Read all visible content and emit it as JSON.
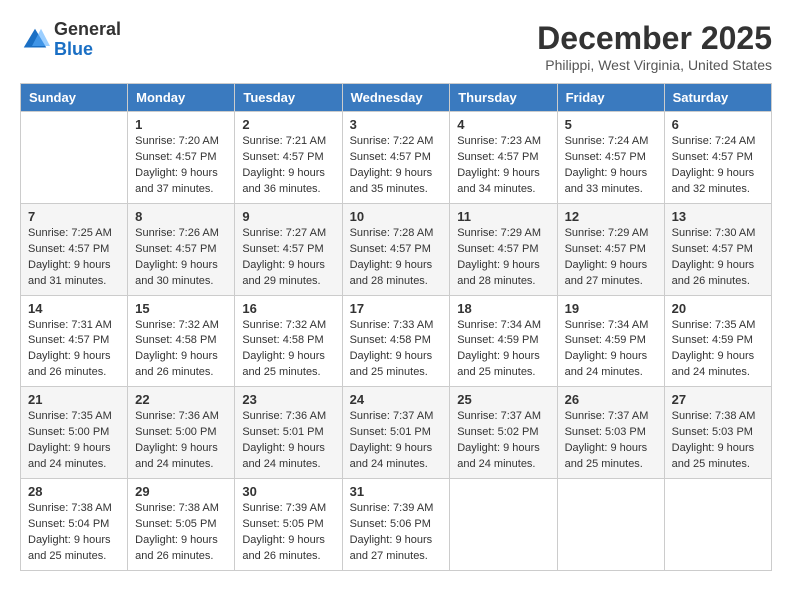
{
  "header": {
    "logo_general": "General",
    "logo_blue": "Blue",
    "month_title": "December 2025",
    "location": "Philippi, West Virginia, United States"
  },
  "calendar": {
    "days_of_week": [
      "Sunday",
      "Monday",
      "Tuesday",
      "Wednesday",
      "Thursday",
      "Friday",
      "Saturday"
    ],
    "weeks": [
      [
        {
          "day": "",
          "info": ""
        },
        {
          "day": "1",
          "info": "Sunrise: 7:20 AM\nSunset: 4:57 PM\nDaylight: 9 hours\nand 37 minutes."
        },
        {
          "day": "2",
          "info": "Sunrise: 7:21 AM\nSunset: 4:57 PM\nDaylight: 9 hours\nand 36 minutes."
        },
        {
          "day": "3",
          "info": "Sunrise: 7:22 AM\nSunset: 4:57 PM\nDaylight: 9 hours\nand 35 minutes."
        },
        {
          "day": "4",
          "info": "Sunrise: 7:23 AM\nSunset: 4:57 PM\nDaylight: 9 hours\nand 34 minutes."
        },
        {
          "day": "5",
          "info": "Sunrise: 7:24 AM\nSunset: 4:57 PM\nDaylight: 9 hours\nand 33 minutes."
        },
        {
          "day": "6",
          "info": "Sunrise: 7:24 AM\nSunset: 4:57 PM\nDaylight: 9 hours\nand 32 minutes."
        }
      ],
      [
        {
          "day": "7",
          "info": "Sunrise: 7:25 AM\nSunset: 4:57 PM\nDaylight: 9 hours\nand 31 minutes."
        },
        {
          "day": "8",
          "info": "Sunrise: 7:26 AM\nSunset: 4:57 PM\nDaylight: 9 hours\nand 30 minutes."
        },
        {
          "day": "9",
          "info": "Sunrise: 7:27 AM\nSunset: 4:57 PM\nDaylight: 9 hours\nand 29 minutes."
        },
        {
          "day": "10",
          "info": "Sunrise: 7:28 AM\nSunset: 4:57 PM\nDaylight: 9 hours\nand 28 minutes."
        },
        {
          "day": "11",
          "info": "Sunrise: 7:29 AM\nSunset: 4:57 PM\nDaylight: 9 hours\nand 28 minutes."
        },
        {
          "day": "12",
          "info": "Sunrise: 7:29 AM\nSunset: 4:57 PM\nDaylight: 9 hours\nand 27 minutes."
        },
        {
          "day": "13",
          "info": "Sunrise: 7:30 AM\nSunset: 4:57 PM\nDaylight: 9 hours\nand 26 minutes."
        }
      ],
      [
        {
          "day": "14",
          "info": "Sunrise: 7:31 AM\nSunset: 4:57 PM\nDaylight: 9 hours\nand 26 minutes."
        },
        {
          "day": "15",
          "info": "Sunrise: 7:32 AM\nSunset: 4:58 PM\nDaylight: 9 hours\nand 26 minutes."
        },
        {
          "day": "16",
          "info": "Sunrise: 7:32 AM\nSunset: 4:58 PM\nDaylight: 9 hours\nand 25 minutes."
        },
        {
          "day": "17",
          "info": "Sunrise: 7:33 AM\nSunset: 4:58 PM\nDaylight: 9 hours\nand 25 minutes."
        },
        {
          "day": "18",
          "info": "Sunrise: 7:34 AM\nSunset: 4:59 PM\nDaylight: 9 hours\nand 25 minutes."
        },
        {
          "day": "19",
          "info": "Sunrise: 7:34 AM\nSunset: 4:59 PM\nDaylight: 9 hours\nand 24 minutes."
        },
        {
          "day": "20",
          "info": "Sunrise: 7:35 AM\nSunset: 4:59 PM\nDaylight: 9 hours\nand 24 minutes."
        }
      ],
      [
        {
          "day": "21",
          "info": "Sunrise: 7:35 AM\nSunset: 5:00 PM\nDaylight: 9 hours\nand 24 minutes."
        },
        {
          "day": "22",
          "info": "Sunrise: 7:36 AM\nSunset: 5:00 PM\nDaylight: 9 hours\nand 24 minutes."
        },
        {
          "day": "23",
          "info": "Sunrise: 7:36 AM\nSunset: 5:01 PM\nDaylight: 9 hours\nand 24 minutes."
        },
        {
          "day": "24",
          "info": "Sunrise: 7:37 AM\nSunset: 5:01 PM\nDaylight: 9 hours\nand 24 minutes."
        },
        {
          "day": "25",
          "info": "Sunrise: 7:37 AM\nSunset: 5:02 PM\nDaylight: 9 hours\nand 24 minutes."
        },
        {
          "day": "26",
          "info": "Sunrise: 7:37 AM\nSunset: 5:03 PM\nDaylight: 9 hours\nand 25 minutes."
        },
        {
          "day": "27",
          "info": "Sunrise: 7:38 AM\nSunset: 5:03 PM\nDaylight: 9 hours\nand 25 minutes."
        }
      ],
      [
        {
          "day": "28",
          "info": "Sunrise: 7:38 AM\nSunset: 5:04 PM\nDaylight: 9 hours\nand 25 minutes."
        },
        {
          "day": "29",
          "info": "Sunrise: 7:38 AM\nSunset: 5:05 PM\nDaylight: 9 hours\nand 26 minutes."
        },
        {
          "day": "30",
          "info": "Sunrise: 7:39 AM\nSunset: 5:05 PM\nDaylight: 9 hours\nand 26 minutes."
        },
        {
          "day": "31",
          "info": "Sunrise: 7:39 AM\nSunset: 5:06 PM\nDaylight: 9 hours\nand 27 minutes."
        },
        {
          "day": "",
          "info": ""
        },
        {
          "day": "",
          "info": ""
        },
        {
          "day": "",
          "info": ""
        }
      ]
    ]
  }
}
